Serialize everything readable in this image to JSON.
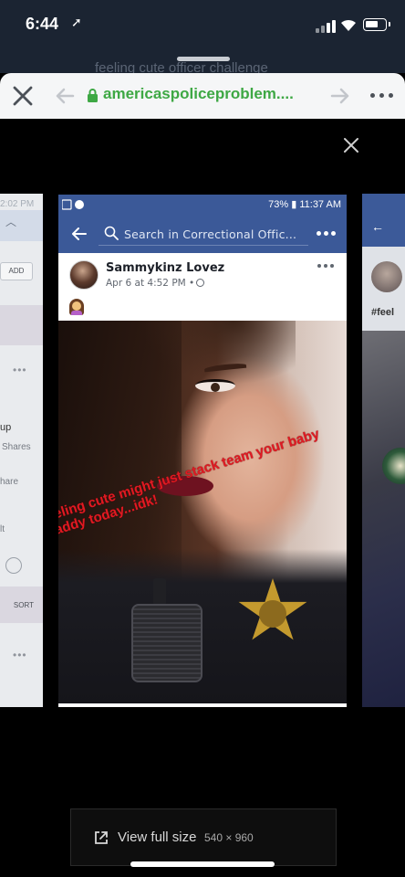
{
  "status_bar": {
    "time": "6:44"
  },
  "browser": {
    "behind_title": "feeling cute officer challenge",
    "url": "americaspoliceproblem...."
  },
  "left_preview": {
    "time": "2:02 PM",
    "add_label": "ADD",
    "text_up": "up",
    "shares_label": "Shares",
    "share_label": "hare",
    "it_label": "lt",
    "sort_label": "SORT"
  },
  "right_preview": {
    "hashtag": "#feel"
  },
  "screenshot": {
    "status_right": "73% ▮ 11:37 AM",
    "search_placeholder": "Search in Correctional Offic...",
    "post": {
      "author": "Sammykinz Lovez",
      "timestamp": "Apr 6 at 4:52 PM •",
      "caption": "feeling cute might just stack team your baby daddy today...idk!"
    }
  },
  "full_size": {
    "label": "View full size",
    "dimensions": "540 × 960"
  },
  "colors": {
    "facebook_blue": "#3b5998",
    "url_green": "#3ea844",
    "caption_red": "#e01a22"
  },
  "icons": [
    "location-arrow-icon",
    "signal-icon",
    "wifi-icon",
    "battery-icon",
    "close-icon",
    "back-arrow-icon",
    "lock-icon",
    "forward-arrow-icon",
    "more-icon",
    "search-icon",
    "globe-icon",
    "external-link-icon"
  ]
}
